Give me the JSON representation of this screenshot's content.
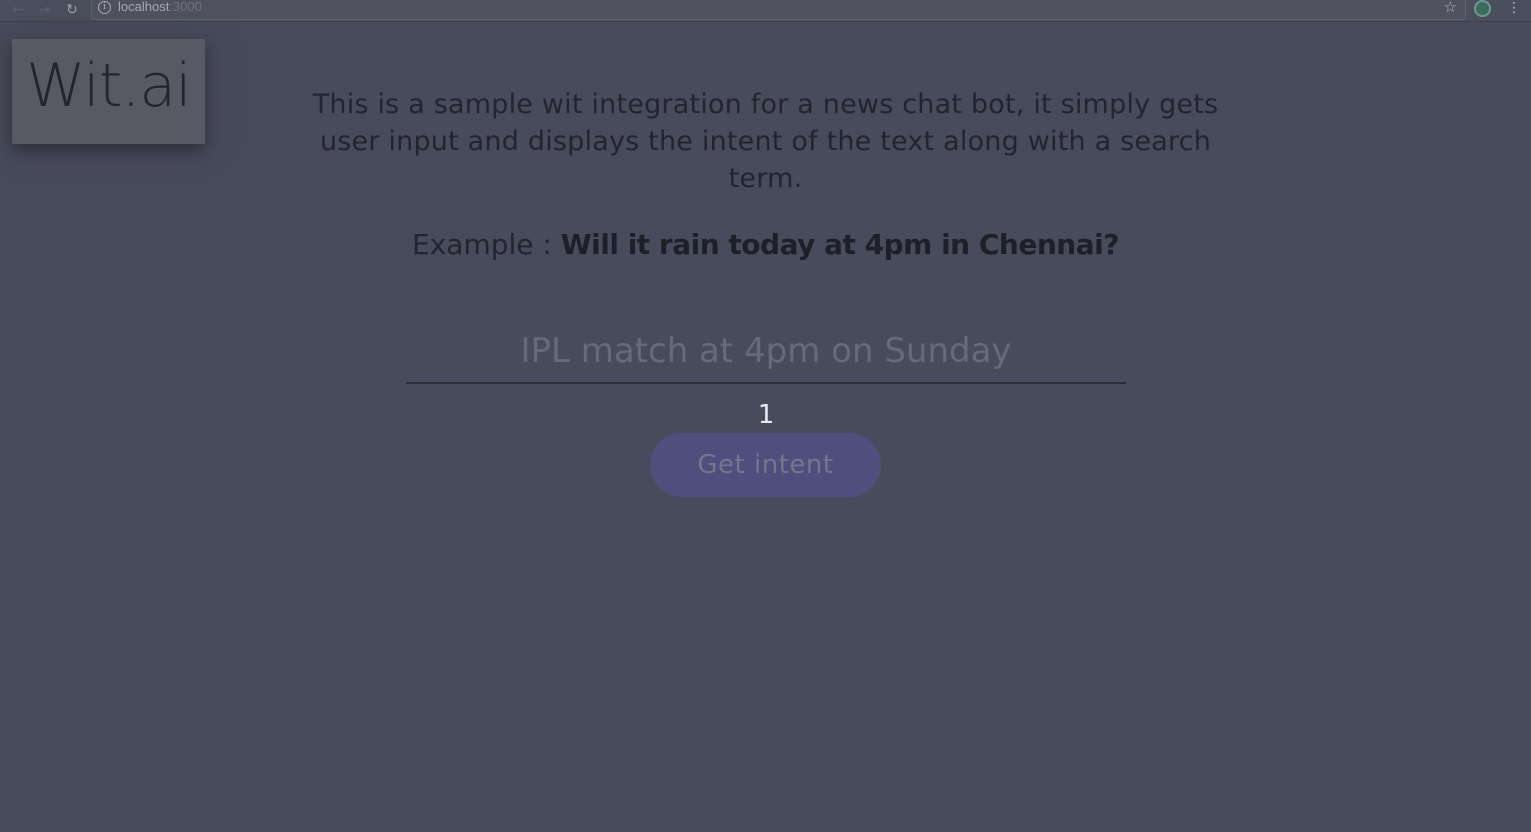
{
  "browser": {
    "url_host": "localhost",
    "url_port": ":3000"
  },
  "logo": {
    "text": "Wit.ai"
  },
  "intro": {
    "description": "This is a sample wit integration for a news chat bot, it simply gets user input and displays the intent of the text along with a search term.",
    "example_label": "Example : ",
    "example_query": "Will it rain today at 4pm in Chennai?"
  },
  "query": {
    "placeholder": "IPL match at 4pm on Sunday",
    "value": ""
  },
  "counter": "1",
  "actions": {
    "get_intent_label": "Get intent"
  }
}
